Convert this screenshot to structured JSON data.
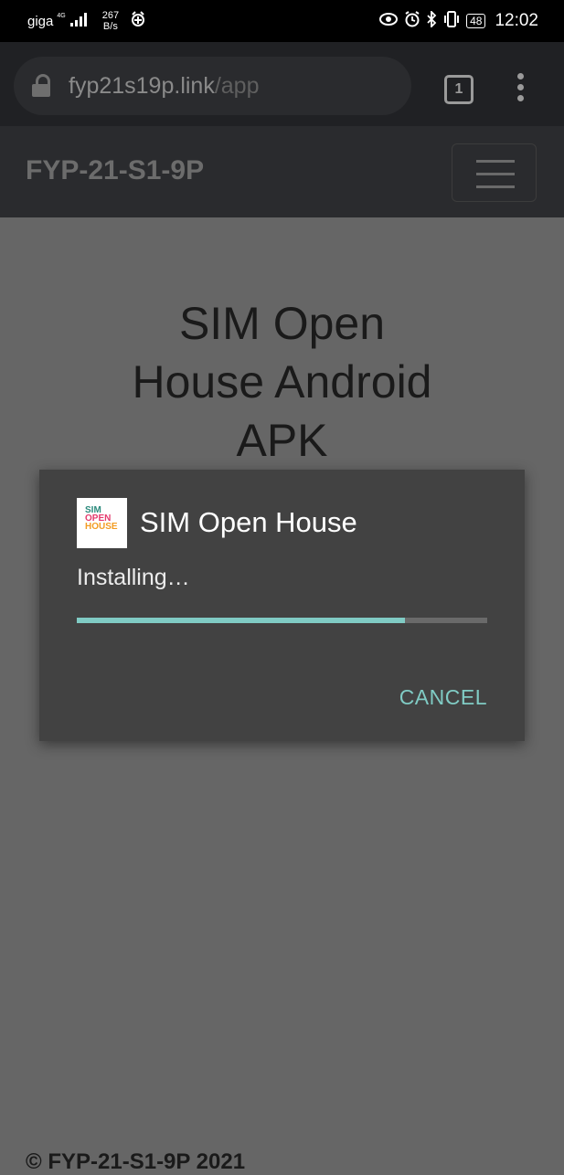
{
  "status_bar": {
    "carrier": "giga",
    "network": "4G",
    "speed_value": "267",
    "speed_unit": "B/s",
    "battery": "48",
    "time": "12:02"
  },
  "browser": {
    "url_domain": "fyp21s19p.link",
    "url_path": "/app",
    "tab_count": "1"
  },
  "navbar": {
    "brand": "FYP-21-S1-9P"
  },
  "page": {
    "title_lines": [
      "SIM Open",
      "House Android",
      "APK"
    ],
    "footer": "© FYP-21-S1-9P 2021"
  },
  "dialog": {
    "icon_lines": [
      "SIM",
      "OPEN",
      "HOUSE"
    ],
    "app_name": "SIM Open House",
    "status": "Installing…",
    "progress": 0.8,
    "cancel_label": "CANCEL"
  },
  "colors": {
    "accent": "#80cbc4",
    "dialog_bg": "#424242",
    "scrim_bg": "#666666"
  }
}
